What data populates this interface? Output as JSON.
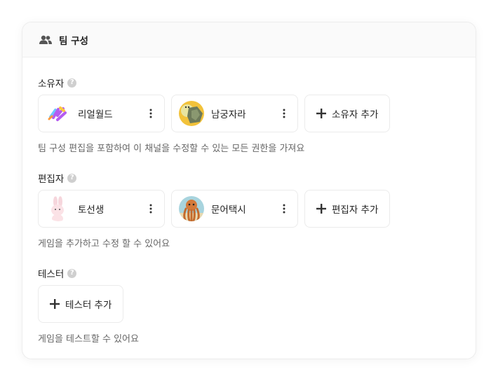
{
  "header": {
    "title": "팀 구성",
    "icon": "people-icon"
  },
  "sections": [
    {
      "label": "소유자",
      "members": [
        {
          "name": "리얼월드",
          "avatar": "realworld-logo"
        },
        {
          "name": "남궁자라",
          "avatar": "turtle-avatar"
        }
      ],
      "add_label": "소유자 추가",
      "description": "팀 구성 편집을 포함하여 이 채널을 수정할 수 있는 모든 권한을 가져요"
    },
    {
      "label": "편집자",
      "members": [
        {
          "name": "토선생",
          "avatar": "rabbit-avatar"
        },
        {
          "name": "문어택시",
          "avatar": "octopus-avatar"
        }
      ],
      "add_label": "편집자 추가",
      "description": "게임을 추가하고 수정 할 수 있어요"
    },
    {
      "label": "테스터",
      "members": [],
      "add_label": "테스터 추가",
      "description": "게임을 테스트할 수 있어요"
    }
  ],
  "help_glyph": "?",
  "colors": {
    "border": "#ebebeb",
    "header_bg": "#fafafa",
    "help": "#cfcfcf",
    "muted_text": "#666666"
  }
}
